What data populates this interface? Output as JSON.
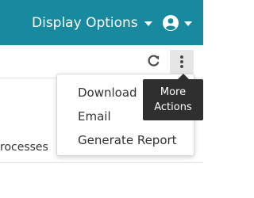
{
  "header": {
    "display_options_label": "Display Options",
    "display_options_icon": "chevron-down-icon",
    "user_icon": "user-circle-icon",
    "user_caret_icon": "chevron-down-icon",
    "background_color": "#188a9f"
  },
  "toolbar": {
    "refresh_icon": "refresh-icon",
    "more_icon": "more-vertical-icon"
  },
  "content": {
    "partial_text": "rocesses"
  },
  "more_actions_menu": {
    "items": [
      {
        "label": "Download"
      },
      {
        "label": "Email"
      },
      {
        "label": "Generate Report"
      }
    ]
  },
  "tooltip": {
    "line1": "More",
    "line2": "Actions"
  }
}
